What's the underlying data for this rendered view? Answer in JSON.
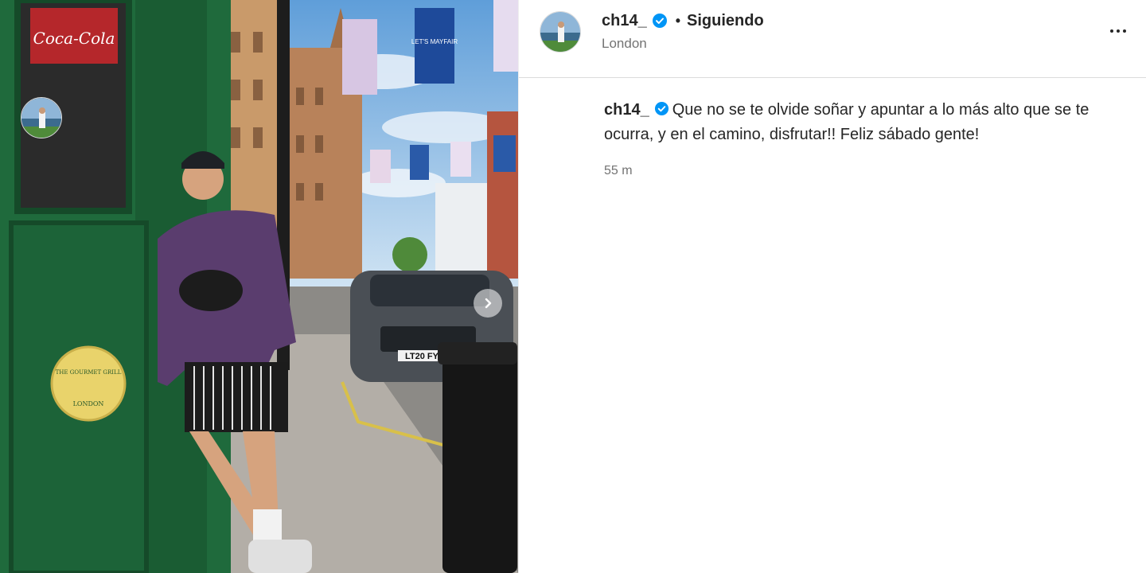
{
  "post": {
    "author": "ch14_",
    "follow_state": "Siguiendo",
    "separator": "•",
    "location": "London",
    "caption": "Que no se te olvide soñar y apuntar a lo más alto que se te ocurra, y en el camino, disfrutar!! Feliz sábado gente!",
    "timestamp": "55 m"
  },
  "photo": {
    "shop_sign_line1": "THE GOURMET GRILL",
    "shop_sign_line2": "LONDON",
    "banner_text": "LET'S MAYFAIR",
    "coca_cola": "Coca-Cola",
    "plate": "LT20 FY"
  },
  "icons": {
    "verified": "verified-badge-icon",
    "more": "more-options-icon",
    "next": "chevron-right-icon"
  },
  "colors": {
    "verified_blue": "#0095f6",
    "shop_green": "#1f6a3c",
    "text_secondary": "#737373"
  }
}
